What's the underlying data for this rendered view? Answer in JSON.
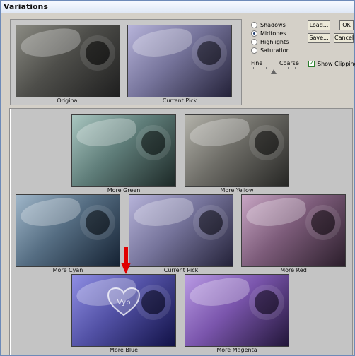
{
  "window": {
    "title": "Variations"
  },
  "thumbs": {
    "original": "Original",
    "current_pick_top": "Current Pick",
    "more_green": "More Green",
    "more_yellow": "More Yellow",
    "more_cyan": "More Cyan",
    "current_pick_main": "Current Pick",
    "more_red": "More Red",
    "more_blue": "More Blue",
    "more_magenta": "More Magenta"
  },
  "options": {
    "tonal": [
      "Shadows",
      "Midtones",
      "Highlights",
      "Saturation"
    ],
    "selected": "Midtones",
    "fine_label": "Fine",
    "coarse_label": "Coarse",
    "show_clipping_label": "Show Clipping",
    "show_clipping_checked": true
  },
  "buttons": {
    "load": "Load...",
    "save": "Save...",
    "ok": "OK",
    "cancel": "Cancel"
  },
  "watermark": "Vyp",
  "colors": {
    "arrow": "#e00000",
    "panel": "#c4c4c4",
    "titlebar_border": "#6d8ab8"
  }
}
